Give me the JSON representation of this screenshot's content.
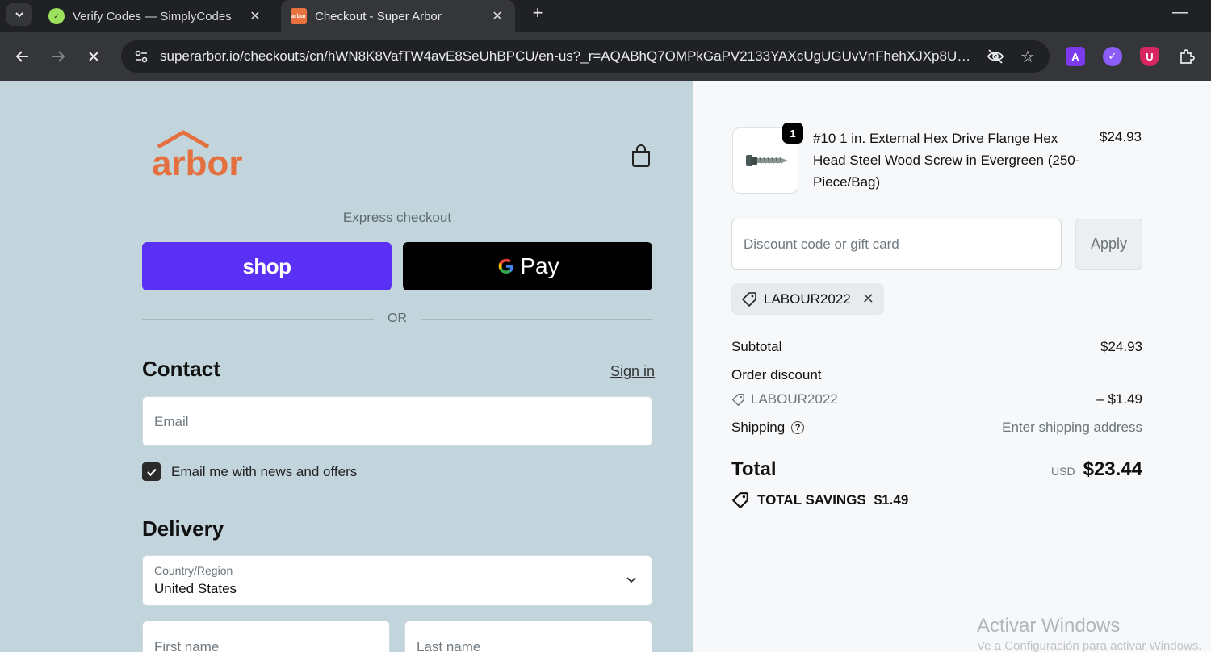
{
  "browser": {
    "tabs": [
      {
        "title": "Verify Codes — SimplyCodes",
        "active": false
      },
      {
        "title": "Checkout - Super Arbor",
        "active": true
      }
    ],
    "url": "superarbor.io/checkouts/cn/hWN8K8VafTW4avE8SeUhBPCU/en-us?_r=AQABhQ7OMPkGaPV2133YAXcUgUGUvVnFhehXJXp8Uli...",
    "icons": [
      "chevron-down-icon",
      "close-icon",
      "plus-icon",
      "back-icon",
      "forward-icon",
      "stop-icon",
      "site-info-icon",
      "eye-off-icon",
      "star-icon",
      "extension-a-icon",
      "extension-b-icon",
      "extension-c-icon",
      "puzzle-icon"
    ]
  },
  "brand": {
    "logo_text": "arbor",
    "accent": "#e5703f"
  },
  "express": {
    "label": "Express checkout",
    "shop_label": "shop",
    "gpay_label": "Pay",
    "or_text": "OR"
  },
  "contact": {
    "heading": "Contact",
    "signin": "Sign in",
    "email_placeholder": "Email",
    "newsletter_label": "Email me with news and offers",
    "newsletter_checked": true
  },
  "delivery": {
    "heading": "Delivery",
    "country_label": "Country/Region",
    "country_value": "United States",
    "first_name_placeholder": "First name",
    "last_name_placeholder": "Last name"
  },
  "summary": {
    "item": {
      "quantity": "1",
      "name": "#10 1 in. External Hex Drive Flange Hex Head Steel Wood Screw in Evergreen (250-Piece/Bag)",
      "price": "$24.93"
    },
    "discount_placeholder": "Discount code or gift card",
    "apply_label": "Apply",
    "applied_code": "LABOUR2022",
    "subtotal_label": "Subtotal",
    "subtotal_value": "$24.93",
    "order_discount_label": "Order discount",
    "discount_code": "LABOUR2022",
    "discount_value": "– $1.49",
    "shipping_label": "Shipping",
    "shipping_value": "Enter shipping address",
    "total_label": "Total",
    "currency": "USD",
    "total_value": "$23.44",
    "savings_label": "TOTAL SAVINGS",
    "savings_value": "$1.49"
  },
  "watermark": {
    "line1": "Activar Windows",
    "line2": "Ve a Configuración para activar Windows."
  }
}
